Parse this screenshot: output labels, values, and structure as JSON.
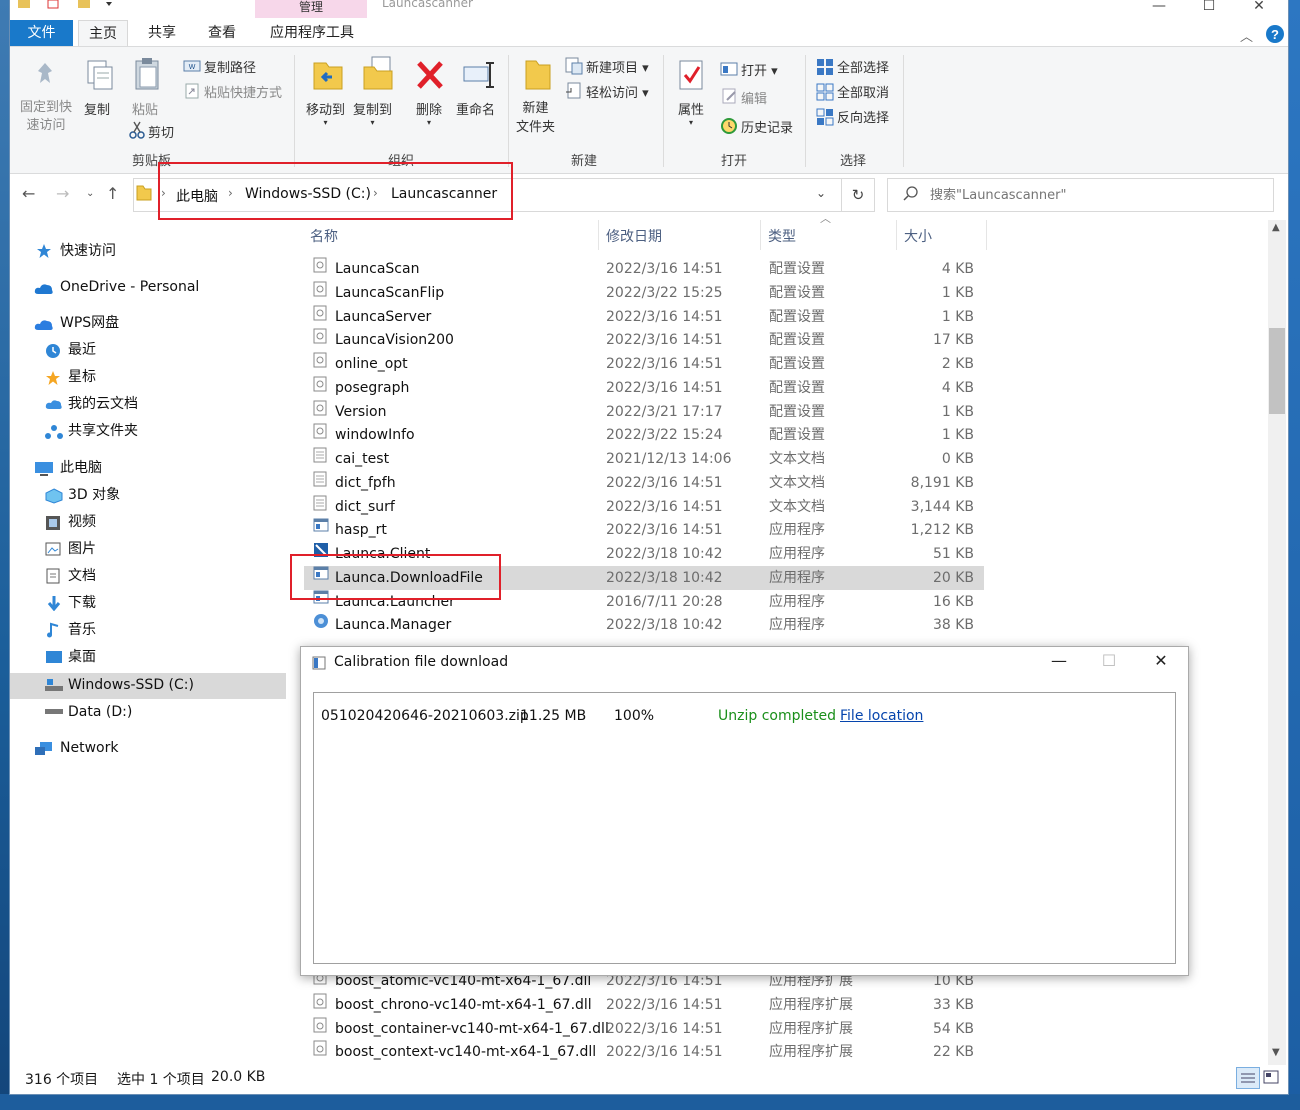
{
  "window": {
    "title": "Launcascanner",
    "manage_tab": "管理",
    "minimize": "—",
    "maximize": "☐",
    "close": "✕"
  },
  "ribbon_tabs": {
    "file": "文件",
    "home": "主页",
    "share": "共享",
    "view": "查看",
    "app_tools": "应用程序工具"
  },
  "ribbon": {
    "clipboard": {
      "pin_quick_access": [
        "固定到快",
        "速访问"
      ],
      "copy": "复制",
      "paste": "粘贴",
      "copy_path": "复制路径",
      "paste_shortcut": "粘贴快捷方式",
      "cut": "剪切",
      "group": "剪贴板"
    },
    "organize": {
      "move_to": "移动到",
      "copy_to": "复制到",
      "delete": "删除",
      "rename": "重命名",
      "group": "组织"
    },
    "new": {
      "new_folder": [
        "新建",
        "文件夹"
      ],
      "new_item": "新建项目",
      "easy_access": "轻松访问",
      "group": "新建"
    },
    "open": {
      "properties": "属性",
      "open": "打开",
      "edit": "编辑",
      "history": "历史记录",
      "group": "打开"
    },
    "select": {
      "select_all": "全部选择",
      "select_none": "全部取消",
      "invert": "反向选择",
      "group": "选择"
    }
  },
  "address": {
    "crumbs": [
      "此电脑",
      "Windows-SSD (C:)",
      "Launcascanner"
    ],
    "search_placeholder": "搜索\"Launcascanner\""
  },
  "nav": {
    "quick_access": "快速访问",
    "onedrive": "OneDrive - Personal",
    "wps": "WPS网盘",
    "recent": "最近",
    "starred": "星标",
    "my_cloud_docs": "我的云文档",
    "shared_folder": "共享文件夹",
    "this_pc": "此电脑",
    "objects3d": "3D 对象",
    "videos": "视频",
    "pictures": "图片",
    "documents": "文档",
    "downloads": "下载",
    "music": "音乐",
    "desktop": "桌面",
    "windows_ssd": "Windows-SSD (C:)",
    "data_d": "Data (D:)",
    "network": "Network"
  },
  "columns": {
    "name": "名称",
    "date": "修改日期",
    "type": "类型",
    "size": "大小"
  },
  "files": [
    {
      "name": "LauncaScan",
      "date": "2022/3/16 14:51",
      "type": "配置设置",
      "size": "4 KB",
      "icon": "config-file"
    },
    {
      "name": "LauncaScanFlip",
      "date": "2022/3/22 15:25",
      "type": "配置设置",
      "size": "1 KB",
      "icon": "config-file"
    },
    {
      "name": "LauncaServer",
      "date": "2022/3/16 14:51",
      "type": "配置设置",
      "size": "1 KB",
      "icon": "config-file"
    },
    {
      "name": "LauncaVision200",
      "date": "2022/3/16 14:51",
      "type": "配置设置",
      "size": "17 KB",
      "icon": "config-file"
    },
    {
      "name": "online_opt",
      "date": "2022/3/16 14:51",
      "type": "配置设置",
      "size": "2 KB",
      "icon": "config-file"
    },
    {
      "name": "posegraph",
      "date": "2022/3/16 14:51",
      "type": "配置设置",
      "size": "4 KB",
      "icon": "config-file"
    },
    {
      "name": "Version",
      "date": "2022/3/21 17:17",
      "type": "配置设置",
      "size": "1 KB",
      "icon": "config-file"
    },
    {
      "name": "windowInfo",
      "date": "2022/3/22 15:24",
      "type": "配置设置",
      "size": "1 KB",
      "icon": "config-file"
    },
    {
      "name": "cai_test",
      "date": "2021/12/13 14:06",
      "type": "文本文档",
      "size": "0 KB",
      "icon": "text-file"
    },
    {
      "name": "dict_fpfh",
      "date": "2022/3/16 14:51",
      "type": "文本文档",
      "size": "8,191 KB",
      "icon": "text-file"
    },
    {
      "name": "dict_surf",
      "date": "2022/3/16 14:51",
      "type": "文本文档",
      "size": "3,144 KB",
      "icon": "text-file"
    },
    {
      "name": "hasp_rt",
      "date": "2022/3/16 14:51",
      "type": "应用程序",
      "size": "1,212 KB",
      "icon": "app-file"
    },
    {
      "name": "Launca.Client",
      "date": "2022/3/18 10:42",
      "type": "应用程序",
      "size": "51 KB",
      "icon": "client-app"
    },
    {
      "name": "Launca.DownloadFile",
      "date": "2022/3/18 10:42",
      "type": "应用程序",
      "size": "20 KB",
      "icon": "app-file"
    },
    {
      "name": "Launca.Launcher",
      "date": "2016/7/11 20:28",
      "type": "应用程序",
      "size": "16 KB",
      "icon": "app-file"
    },
    {
      "name": "Launca.Manager",
      "date": "2022/3/18 10:42",
      "type": "应用程序",
      "size": "38 KB",
      "icon": "manager-app"
    }
  ],
  "files_bottom": [
    {
      "name": "boost_atomic-vc140-mt-x64-1_67.dll",
      "date": "2022/3/16 14:51",
      "type": "应用程序扩展",
      "size": "10 KB"
    },
    {
      "name": "boost_chrono-vc140-mt-x64-1_67.dll",
      "date": "2022/3/16 14:51",
      "type": "应用程序扩展",
      "size": "33 KB"
    },
    {
      "name": "boost_container-vc140-mt-x64-1_67.dll",
      "date": "2022/3/16 14:51",
      "type": "应用程序扩展",
      "size": "54 KB"
    },
    {
      "name": "boost_context-vc140-mt-x64-1_67.dll",
      "date": "2022/3/16 14:51",
      "type": "应用程序扩展",
      "size": "22 KB"
    }
  ],
  "status": {
    "count": "316 个项目",
    "selected": "选中 1 个项目",
    "selected_size": "20.0 KB"
  },
  "dialog": {
    "title": "Calibration file download",
    "filename": "051020420646-20210603.zip",
    "size": "11.25 MB",
    "progress": "100%",
    "progress_fraction": 1.0,
    "status": "Unzip completed",
    "link": "File location"
  },
  "colors": {
    "accent": "#1979ca",
    "highlight": "#e0202a",
    "success": "#1a8f1a",
    "link": "#0645ad",
    "selection": "#d9d9d9"
  }
}
